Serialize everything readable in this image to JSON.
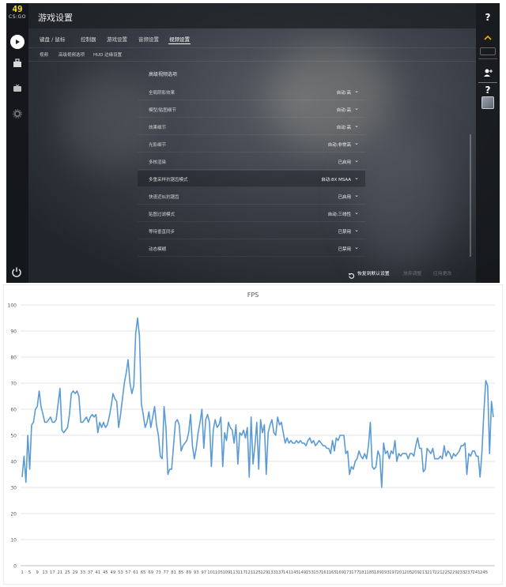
{
  "logo": {
    "number": "49",
    "text": "CS:GO"
  },
  "header": {
    "title": "游戏设置"
  },
  "tabs": [
    {
      "label": "键盘 / 鼠标",
      "active": false
    },
    {
      "label": "控制器",
      "active": false
    },
    {
      "label": "游戏设置",
      "active": false
    },
    {
      "label": "音频设置",
      "active": false
    },
    {
      "label": "视频设置",
      "active": true
    }
  ],
  "subtabs": [
    {
      "label": "视频"
    },
    {
      "label": "高级视频选项"
    },
    {
      "label": "HUD 边缘设置"
    }
  ],
  "panel": {
    "title": "高级视频选项",
    "rows": [
      {
        "label": "全局阴影效果",
        "value": "自动:高"
      },
      {
        "label": "模型/贴图细节",
        "value": "自动:高"
      },
      {
        "label": "效果细节",
        "value": "自动:高"
      },
      {
        "label": "光影细节",
        "value": "自动:非常高"
      },
      {
        "label": "多核渲染",
        "value": "已启用"
      },
      {
        "label": "多重采样抗锯齿模式",
        "value": "自动:8X MSAA"
      },
      {
        "label": "快速近似抗锯齿",
        "value": "已启用"
      },
      {
        "label": "贴图过滤模式",
        "value": "自动:三线性"
      },
      {
        "label": "等待垂直同步",
        "value": "已禁用"
      },
      {
        "label": "动态模糊",
        "value": "已禁用"
      }
    ]
  },
  "bottom": {
    "reset_label": "恢复到默认设置",
    "discard_label": "放弃调整",
    "apply_label": "应用更改"
  },
  "rightbar": {
    "help1": "?",
    "help2": "?"
  },
  "chart_data": {
    "type": "line",
    "title": "FPS",
    "ylim": [
      0,
      100
    ],
    "yticks": [
      0,
      10,
      20,
      30,
      40,
      50,
      60,
      70,
      80,
      90,
      100
    ],
    "x_tick_labels": [
      "1",
      "5",
      "9",
      "13",
      "17",
      "21",
      "25",
      "29",
      "33",
      "37",
      "41",
      "45",
      "49",
      "53",
      "57",
      "61",
      "65",
      "69",
      "73",
      "77",
      "81",
      "85",
      "89",
      "93",
      "97",
      "101",
      "105",
      "109",
      "113",
      "117",
      "121",
      "125",
      "129",
      "133",
      "137",
      "141",
      "145",
      "149",
      "153",
      "157",
      "161",
      "165",
      "169",
      "173",
      "177",
      "181",
      "185",
      "189",
      "193",
      "197",
      "201",
      "205",
      "209",
      "213",
      "217",
      "221",
      "225",
      "229",
      "233",
      "237",
      "241",
      "245"
    ],
    "grid": true,
    "series": [
      {
        "color": "#5b9bd5",
        "values": [
          34,
          42,
          32,
          50,
          37,
          54,
          55,
          60,
          61,
          67,
          61,
          58,
          55,
          55,
          56,
          57,
          55,
          55,
          56,
          62,
          68,
          52,
          51,
          52,
          53,
          58,
          66,
          67,
          66,
          67,
          65,
          55,
          55,
          56,
          57,
          55,
          57,
          58,
          57,
          58,
          51,
          55,
          53,
          55,
          53,
          54,
          57,
          61,
          66,
          64,
          63,
          53,
          58,
          64,
          70,
          74,
          79,
          70,
          66,
          69,
          89,
          95,
          88,
          62,
          58,
          53,
          55,
          59,
          53,
          57,
          61,
          54,
          50,
          42,
          41,
          61,
          53,
          35,
          37,
          37,
          46,
          55,
          56,
          54,
          44,
          46,
          47,
          48,
          51,
          58,
          46,
          41,
          45,
          51,
          55,
          60,
          45,
          56,
          58,
          55,
          38,
          52,
          56,
          53,
          54,
          57,
          38,
          51,
          48,
          55,
          53,
          52,
          47,
          54,
          39,
          51,
          50,
          52,
          49,
          53,
          34,
          57,
          39,
          46,
          55,
          37,
          56,
          51,
          54,
          35,
          51,
          54,
          56,
          51,
          50,
          57,
          54,
          55,
          51,
          47,
          49,
          47,
          48,
          47,
          47,
          48,
          47,
          48,
          47,
          47,
          46,
          48,
          49,
          47,
          48,
          46,
          47,
          48,
          47,
          46,
          46,
          45,
          45,
          43,
          48,
          44,
          49,
          48,
          50,
          50,
          50,
          43,
          44,
          35,
          38,
          37,
          40,
          41,
          44,
          42,
          41,
          43,
          41,
          46,
          55,
          38,
          37,
          38,
          44,
          42,
          30,
          47,
          43,
          44,
          41,
          44,
          43,
          48,
          40,
          43,
          42,
          43,
          43,
          43,
          41,
          43,
          43,
          42,
          46,
          49,
          45,
          45,
          36,
          37,
          45,
          44,
          43,
          45,
          41,
          41,
          41,
          42,
          41,
          46,
          42,
          44,
          43,
          41,
          43,
          42,
          43,
          44,
          46,
          46,
          47,
          35,
          43,
          42,
          44,
          44,
          42,
          42,
          34,
          44,
          59,
          71,
          69,
          43,
          63,
          57
        ]
      }
    ]
  }
}
